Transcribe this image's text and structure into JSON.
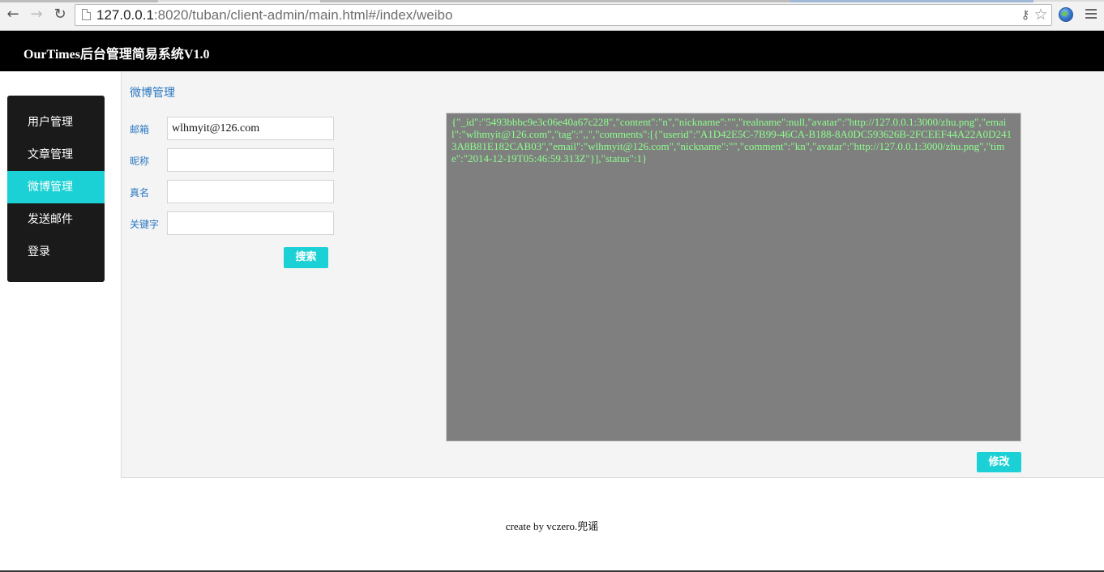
{
  "browser": {
    "url_host": "127.0.0.1",
    "url_rest": ":8020/tuban/client-admin/main.html#/index/weibo"
  },
  "app": {
    "title": "OurTimes后台管理简易系统V1.0"
  },
  "sidebar": {
    "items": [
      {
        "label": "用户管理",
        "active": false
      },
      {
        "label": "文章管理",
        "active": false
      },
      {
        "label": "微博管理",
        "active": true
      },
      {
        "label": "发送邮件",
        "active": false
      },
      {
        "label": "登录",
        "active": false
      }
    ]
  },
  "main": {
    "title": "微博管理",
    "form": {
      "email_label": "邮箱",
      "email_value": "wlhmyit@126.com",
      "nickname_label": "昵称",
      "nickname_value": "",
      "realname_label": "真名",
      "realname_value": "",
      "keyword_label": "关键字",
      "keyword_value": "",
      "search_button": "搜索"
    },
    "json_text": "{\"_id\":\"5493bbbc9e3c06e40a67c228\",\"content\":\"n\",\"nickname\":\"\",\"realname\":null,\"avatar\":\"http://127.0.0.1:3000/zhu.png\",\"email\":\"wlhmyit@126.com\",\"tag\":\",,\",\"comments\":[{\"userid\":\"A1D42E5C-7B99-46CA-B188-8A0DC593626B-2FCEEF44A22A0D2413A8B81E182CAB03\",\"email\":\"wlhmyit@126.com\",\"nickname\":\"\",\"comment\":\"kn\",\"avatar\":\"http://127.0.0.1:3000/zhu.png\",\"time\":\"2014-12-19T05:46:59.313Z\"}],\"status\":1}",
    "modify_button": "修改"
  },
  "footer": {
    "text": "create by vczero.兜谣"
  },
  "colors": {
    "accent": "#1cd1d6",
    "header_bg": "#000000",
    "sidebar_bg": "#1a1a1a",
    "label_blue": "#2a78c2",
    "json_bg": "#7f7f7f",
    "json_text": "#8cff8c"
  }
}
